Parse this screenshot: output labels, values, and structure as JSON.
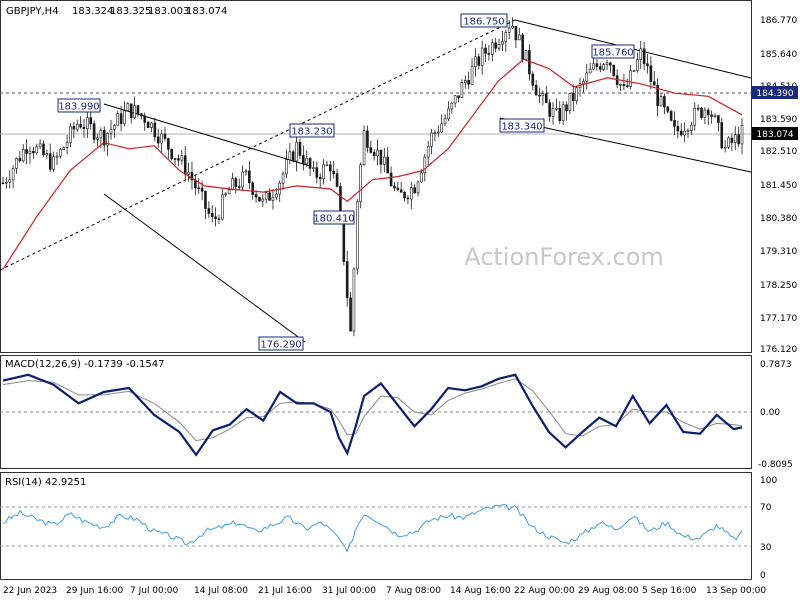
{
  "chart_data": [
    {
      "type": "candlestick",
      "title": "GBPJPY,H4",
      "ohlc": {
        "open": "183.324",
        "high": "183.325",
        "low": "183.003",
        "close": "183.074"
      },
      "watermark": "ActionForex.com",
      "ylim": [
        176.0,
        187.0
      ],
      "y_ticks": [
        "186.770",
        "185.640",
        "184.510",
        "183.590",
        "182.510",
        "181.450",
        "180.380",
        "179.310",
        "178.250",
        "177.170",
        "176.120"
      ],
      "x_ticks": [
        "22 Jun 2023",
        "29 Jun 16:00",
        "7 Jul 00:00",
        "14 Jul 08:00",
        "21 Jul 16:00",
        "31 Jul 00:00",
        "7 Aug 08:00",
        "14 Aug 16:00",
        "22 Aug 00:00",
        "29 Aug 08:00",
        "5 Sep 16:00",
        "13 Sep 00:00"
      ],
      "price_markers": [
        {
          "label": "184.390",
          "color": "#1a2a78"
        },
        {
          "label": "183.074",
          "color": "#000000"
        }
      ],
      "annotations": [
        "186.750",
        "185.760",
        "183.990",
        "183.230",
        "183.340",
        "180.410",
        "176.290"
      ],
      "price_path": [
        {
          "t": 0,
          "p": 181.5
        },
        {
          "t": 3,
          "p": 182.8
        },
        {
          "t": 6,
          "p": 182.1
        },
        {
          "t": 9,
          "p": 183.5
        },
        {
          "t": 12,
          "p": 183.0
        },
        {
          "t": 15,
          "p": 183.9
        },
        {
          "t": 17,
          "p": 183.6
        },
        {
          "t": 19,
          "p": 182.9
        },
        {
          "t": 22,
          "p": 181.9
        },
        {
          "t": 25,
          "p": 180.2
        },
        {
          "t": 27,
          "p": 181.3
        },
        {
          "t": 29,
          "p": 181.7
        },
        {
          "t": 31,
          "p": 180.8
        },
        {
          "t": 33,
          "p": 181.6
        },
        {
          "t": 35,
          "p": 182.7
        },
        {
          "t": 37,
          "p": 181.7
        },
        {
          "t": 39,
          "p": 182.1
        },
        {
          "t": 40,
          "p": 180.9
        },
        {
          "t": 41.5,
          "p": 176.29
        },
        {
          "t": 42,
          "p": 180.5
        },
        {
          "t": 43,
          "p": 183.1
        },
        {
          "t": 45,
          "p": 182.3
        },
        {
          "t": 47,
          "p": 181.0
        },
        {
          "t": 49,
          "p": 181.4
        },
        {
          "t": 51,
          "p": 183.0
        },
        {
          "t": 53,
          "p": 183.7
        },
        {
          "t": 55,
          "p": 184.8
        },
        {
          "t": 57,
          "p": 185.6
        },
        {
          "t": 59,
          "p": 186.2
        },
        {
          "t": 60.5,
          "p": 186.75
        },
        {
          "t": 62,
          "p": 185.7
        },
        {
          "t": 64,
          "p": 184.2
        },
        {
          "t": 66,
          "p": 183.6
        },
        {
          "t": 68,
          "p": 184.3
        },
        {
          "t": 70,
          "p": 185.1
        },
        {
          "t": 72,
          "p": 185.6
        },
        {
          "t": 74,
          "p": 184.4
        },
        {
          "t": 76,
          "p": 185.7
        },
        {
          "t": 78,
          "p": 184.2
        },
        {
          "t": 80,
          "p": 183.1
        },
        {
          "t": 82,
          "p": 183.6
        },
        {
          "t": 84,
          "p": 184.0
        },
        {
          "t": 86,
          "p": 182.6
        },
        {
          "t": 88,
          "p": 183.1
        }
      ],
      "ma_path": [
        {
          "t": 0,
          "p": 178.7
        },
        {
          "t": 4,
          "p": 180.4
        },
        {
          "t": 8,
          "p": 181.9
        },
        {
          "t": 12,
          "p": 182.8
        },
        {
          "t": 15,
          "p": 182.6
        },
        {
          "t": 18,
          "p": 182.7
        },
        {
          "t": 21,
          "p": 181.9
        },
        {
          "t": 24,
          "p": 181.4
        },
        {
          "t": 27,
          "p": 181.3
        },
        {
          "t": 31,
          "p": 181.2
        },
        {
          "t": 35,
          "p": 181.4
        },
        {
          "t": 39,
          "p": 181.3
        },
        {
          "t": 41,
          "p": 180.9
        },
        {
          "t": 44,
          "p": 181.6
        },
        {
          "t": 47,
          "p": 181.7
        },
        {
          "t": 50,
          "p": 181.9
        },
        {
          "t": 53,
          "p": 182.6
        },
        {
          "t": 56,
          "p": 183.7
        },
        {
          "t": 59,
          "p": 184.8
        },
        {
          "t": 62,
          "p": 185.5
        },
        {
          "t": 65,
          "p": 185.2
        },
        {
          "t": 68,
          "p": 184.6
        },
        {
          "t": 72,
          "p": 184.9
        },
        {
          "t": 76,
          "p": 184.7
        },
        {
          "t": 80,
          "p": 184.4
        },
        {
          "t": 84,
          "p": 184.3
        },
        {
          "t": 88,
          "p": 183.7
        }
      ]
    },
    {
      "type": "line",
      "title": "MACD(12,26,9) -0.1739 -0.1547",
      "y_ticks": [
        "0.7873",
        "0.00",
        "-0.8095"
      ],
      "ylim": [
        -0.85,
        0.85
      ],
      "series": [
        {
          "role": "macd",
          "color": "#0a1f6e",
          "points": [
            {
              "t": 0,
              "v": 0.55
            },
            {
              "t": 3,
              "v": 0.65
            },
            {
              "t": 6,
              "v": 0.48
            },
            {
              "t": 9,
              "v": 0.15
            },
            {
              "t": 12,
              "v": 0.35
            },
            {
              "t": 15,
              "v": 0.42
            },
            {
              "t": 18,
              "v": -0.05
            },
            {
              "t": 21,
              "v": -0.35
            },
            {
              "t": 23,
              "v": -0.75
            },
            {
              "t": 25,
              "v": -0.32
            },
            {
              "t": 27,
              "v": -0.22
            },
            {
              "t": 29,
              "v": 0.05
            },
            {
              "t": 31,
              "v": -0.15
            },
            {
              "t": 33,
              "v": 0.35
            },
            {
              "t": 35,
              "v": 0.15
            },
            {
              "t": 37,
              "v": 0.15
            },
            {
              "t": 39,
              "v": 0.0
            },
            {
              "t": 40,
              "v": -0.45
            },
            {
              "t": 41,
              "v": -0.72
            },
            {
              "t": 42,
              "v": -0.25
            },
            {
              "t": 43,
              "v": 0.28
            },
            {
              "t": 45,
              "v": 0.5
            },
            {
              "t": 47,
              "v": 0.12
            },
            {
              "t": 49,
              "v": -0.25
            },
            {
              "t": 51,
              "v": 0.05
            },
            {
              "t": 53,
              "v": 0.42
            },
            {
              "t": 55,
              "v": 0.38
            },
            {
              "t": 57,
              "v": 0.45
            },
            {
              "t": 59,
              "v": 0.58
            },
            {
              "t": 61,
              "v": 0.65
            },
            {
              "t": 63,
              "v": 0.12
            },
            {
              "t": 65,
              "v": -0.35
            },
            {
              "t": 67,
              "v": -0.62
            },
            {
              "t": 69,
              "v": -0.35
            },
            {
              "t": 71,
              "v": -0.1
            },
            {
              "t": 73,
              "v": -0.25
            },
            {
              "t": 75,
              "v": 0.28
            },
            {
              "t": 77,
              "v": -0.2
            },
            {
              "t": 79,
              "v": 0.12
            },
            {
              "t": 81,
              "v": -0.35
            },
            {
              "t": 83,
              "v": -0.38
            },
            {
              "t": 85,
              "v": -0.05
            },
            {
              "t": 87,
              "v": -0.3
            },
            {
              "t": 88,
              "v": -0.27
            }
          ]
        },
        {
          "role": "signal",
          "color": "#8a8a8a",
          "points": [
            {
              "t": 0,
              "v": 0.48
            },
            {
              "t": 3,
              "v": 0.55
            },
            {
              "t": 6,
              "v": 0.52
            },
            {
              "t": 9,
              "v": 0.3
            },
            {
              "t": 12,
              "v": 0.3
            },
            {
              "t": 15,
              "v": 0.36
            },
            {
              "t": 18,
              "v": 0.15
            },
            {
              "t": 21,
              "v": -0.18
            },
            {
              "t": 23,
              "v": -0.5
            },
            {
              "t": 25,
              "v": -0.45
            },
            {
              "t": 27,
              "v": -0.3
            },
            {
              "t": 29,
              "v": -0.1
            },
            {
              "t": 31,
              "v": -0.08
            },
            {
              "t": 33,
              "v": 0.15
            },
            {
              "t": 35,
              "v": 0.18
            },
            {
              "t": 37,
              "v": 0.14
            },
            {
              "t": 39,
              "v": 0.05
            },
            {
              "t": 40,
              "v": -0.15
            },
            {
              "t": 41,
              "v": -0.4
            },
            {
              "t": 42,
              "v": -0.38
            },
            {
              "t": 43,
              "v": -0.08
            },
            {
              "t": 45,
              "v": 0.28
            },
            {
              "t": 47,
              "v": 0.25
            },
            {
              "t": 49,
              "v": 0.0
            },
            {
              "t": 51,
              "v": -0.05
            },
            {
              "t": 53,
              "v": 0.2
            },
            {
              "t": 55,
              "v": 0.33
            },
            {
              "t": 57,
              "v": 0.4
            },
            {
              "t": 59,
              "v": 0.5
            },
            {
              "t": 61,
              "v": 0.58
            },
            {
              "t": 63,
              "v": 0.38
            },
            {
              "t": 65,
              "v": 0.02
            },
            {
              "t": 67,
              "v": -0.38
            },
            {
              "t": 69,
              "v": -0.42
            },
            {
              "t": 71,
              "v": -0.25
            },
            {
              "t": 73,
              "v": -0.22
            },
            {
              "t": 75,
              "v": 0.05
            },
            {
              "t": 77,
              "v": 0.0
            },
            {
              "t": 79,
              "v": 0.0
            },
            {
              "t": 81,
              "v": -0.18
            },
            {
              "t": 83,
              "v": -0.3
            },
            {
              "t": 85,
              "v": -0.2
            },
            {
              "t": 87,
              "v": -0.22
            },
            {
              "t": 88,
              "v": -0.24
            }
          ]
        }
      ]
    },
    {
      "type": "line",
      "title": "RSI(14) 42.9251",
      "y_ticks": [
        "100",
        "70",
        "30",
        "0"
      ],
      "levels": [
        70,
        30
      ],
      "ylim": [
        0,
        100
      ],
      "series": [
        {
          "role": "rsi",
          "color": "#3ea0e8",
          "points": [
            {
              "t": 0,
              "v": 55
            },
            {
              "t": 2,
              "v": 65
            },
            {
              "t": 4,
              "v": 58
            },
            {
              "t": 6,
              "v": 52
            },
            {
              "t": 8,
              "v": 64
            },
            {
              "t": 10,
              "v": 55
            },
            {
              "t": 12,
              "v": 50
            },
            {
              "t": 14,
              "v": 62
            },
            {
              "t": 16,
              "v": 58
            },
            {
              "t": 18,
              "v": 45
            },
            {
              "t": 20,
              "v": 40
            },
            {
              "t": 22,
              "v": 32
            },
            {
              "t": 24,
              "v": 45
            },
            {
              "t": 26,
              "v": 50
            },
            {
              "t": 28,
              "v": 55
            },
            {
              "t": 30,
              "v": 45
            },
            {
              "t": 32,
              "v": 52
            },
            {
              "t": 34,
              "v": 60
            },
            {
              "t": 36,
              "v": 48
            },
            {
              "t": 38,
              "v": 55
            },
            {
              "t": 40,
              "v": 38
            },
            {
              "t": 41,
              "v": 22
            },
            {
              "t": 42,
              "v": 48
            },
            {
              "t": 43,
              "v": 65
            },
            {
              "t": 45,
              "v": 55
            },
            {
              "t": 47,
              "v": 42
            },
            {
              "t": 49,
              "v": 45
            },
            {
              "t": 51,
              "v": 58
            },
            {
              "t": 53,
              "v": 62
            },
            {
              "t": 55,
              "v": 60
            },
            {
              "t": 57,
              "v": 68
            },
            {
              "t": 59,
              "v": 72
            },
            {
              "t": 61,
              "v": 70
            },
            {
              "t": 63,
              "v": 50
            },
            {
              "t": 65,
              "v": 40
            },
            {
              "t": 67,
              "v": 33
            },
            {
              "t": 69,
              "v": 42
            },
            {
              "t": 71,
              "v": 55
            },
            {
              "t": 73,
              "v": 48
            },
            {
              "t": 75,
              "v": 62
            },
            {
              "t": 77,
              "v": 45
            },
            {
              "t": 79,
              "v": 55
            },
            {
              "t": 81,
              "v": 40
            },
            {
              "t": 83,
              "v": 38
            },
            {
              "t": 85,
              "v": 52
            },
            {
              "t": 87,
              "v": 37
            },
            {
              "t": 88,
              "v": 43
            }
          ]
        }
      ]
    }
  ],
  "colors": {
    "candle_up": "#1a1a1a",
    "candle_down": "#1a1a1a",
    "ma": "#d21f1f",
    "trendline": "#000000",
    "label_border": "#1a2a78",
    "macd_zero": "#888888",
    "grid": "#999999"
  }
}
